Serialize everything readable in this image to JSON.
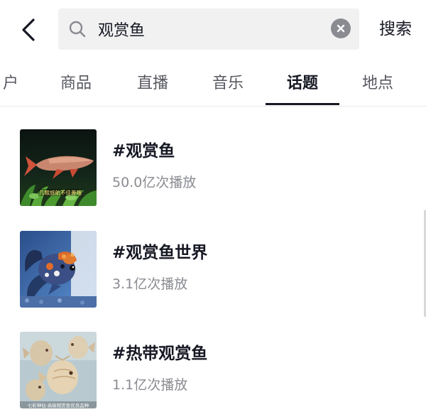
{
  "search": {
    "query": "观赏鱼",
    "submit_label": "搜索"
  },
  "tabs": [
    {
      "label": "户",
      "active": false
    },
    {
      "label": "商品",
      "active": false
    },
    {
      "label": "直播",
      "active": false
    },
    {
      "label": "音乐",
      "active": false
    },
    {
      "label": "话题",
      "active": true
    },
    {
      "label": "地点",
      "active": false
    }
  ],
  "results": [
    {
      "title": "#观赏鱼",
      "plays": "50.0亿次播放",
      "thumb_caption": "几眼旅航不佳善哦"
    },
    {
      "title": "#观赏鱼世界",
      "plays": "3.1亿次播放"
    },
    {
      "title": "#热带观赏鱼",
      "plays": "1.1亿次播放",
      "thumb_caption": "七彩神仙·高级观赏鱼优良品种"
    }
  ],
  "icons": {
    "back": "chevron-left-icon",
    "search": "magnifier-icon",
    "clear": "close-circle-icon"
  },
  "colors": {
    "text_primary": "#161823",
    "text_secondary": "#8a8b91",
    "search_bg": "#f1f1f2",
    "tab_indicator": "#161823"
  }
}
